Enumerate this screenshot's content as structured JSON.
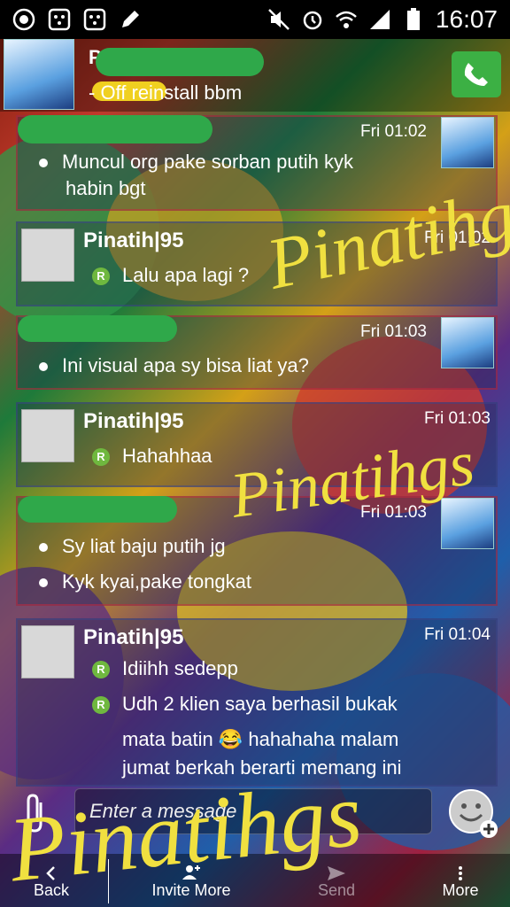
{
  "status_bar": {
    "time": "16:07",
    "left_icons": [
      "whatsapp-icon",
      "bbm-icon",
      "bbm-icon",
      "pencil-icon"
    ],
    "right_icons": [
      "mute-icon",
      "alarm-icon",
      "wifi-icon",
      "signal-icon",
      "battery-icon"
    ]
  },
  "header": {
    "contact_name": "P",
    "status": "- Off reinstall bbm"
  },
  "messages": [
    {
      "type": "out",
      "time": "Fri 01:02",
      "lines": [
        "Muncul org pake sorban putih kyk",
        "habin bgt"
      ]
    },
    {
      "type": "in",
      "sender": "Pinatih|95",
      "time": "Fri 01:02",
      "lines": [
        "Lalu apa lagi ?"
      ]
    },
    {
      "type": "out",
      "time": "Fri 01:03",
      "lines": [
        "Ini visual apa sy bisa liat ya?"
      ]
    },
    {
      "type": "in",
      "sender": "Pinatih|95",
      "time": "Fri 01:03",
      "lines": [
        "Hahahhaa"
      ]
    },
    {
      "type": "out",
      "time": "Fri 01:03",
      "lines": [
        "Sy liat baju putih jg",
        "Kyk kyai,pake tongkat"
      ]
    },
    {
      "type": "in",
      "sender": "Pinatih|95",
      "time": "Fri 01:04",
      "lines": [
        "Idiihh sedepp",
        "Udh 2 klien saya berhasil bukak",
        "mata batin 😂 hahahaha malam",
        "jumat berkah berarti memang ini"
      ]
    }
  ],
  "composer": {
    "placeholder": "Enter a message"
  },
  "bottom_bar": {
    "back": "Back",
    "invite": "Invite More",
    "send": "Send",
    "more": "More"
  },
  "watermark": "Pinatihgs",
  "watermark_small": "Pinatihgs",
  "watermark_mid": "Pinatihgs",
  "colors": {
    "call_button": "#3cb044",
    "r_badge": "#6fb83f",
    "watermark": "#f0e040"
  }
}
